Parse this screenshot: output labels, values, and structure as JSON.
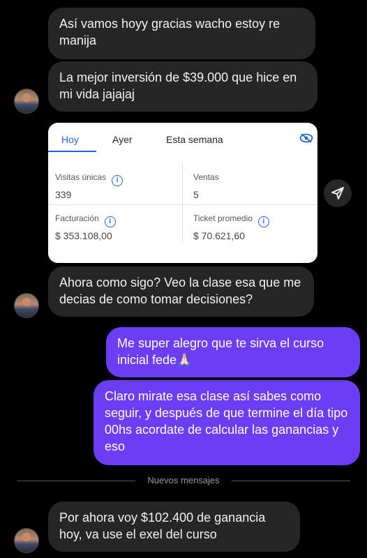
{
  "messages": {
    "m1": "Así vamos hoyy gracias wacho estoy re manija",
    "m2": "La mejor inversión de $39.000 que hice en mi vida jajajaj",
    "m3": "Ahora como sigo? Veo la clase esa que me decias de como tomar decisiones?",
    "m4": "Me super alegro que te sirva el curso inicial fede🙏🏻",
    "m5": "Claro mirate esa clase así sabes como seguir, y después de que termine el día tipo 00hs acordate de calcular las ganancias y eso",
    "m6": "Por ahora voy $102.400 de ganancia hoy, va use el exel del curso"
  },
  "card": {
    "tabs": [
      "Hoy",
      "Ayer",
      "Esta semana"
    ],
    "active_tab": "Hoy",
    "metrics": {
      "visitas_label": "Visitas únicas",
      "visitas_value": "339",
      "ventas_label": "Ventas",
      "ventas_value": "5",
      "facturacion_label": "Facturación",
      "facturacion_value": "$ 353.108,00",
      "ticket_label": "Ticket promedio",
      "ticket_value": "$ 70.621,60"
    },
    "info_glyph": "i"
  },
  "divider": {
    "label": "Nuevos mensajes"
  },
  "icons": {
    "share": "send-icon",
    "eye": "eye-off-icon",
    "avatar": "avatar"
  },
  "colors": {
    "outgoing": "#6b3df5",
    "incoming": "#262626",
    "accent": "#2563d6"
  }
}
